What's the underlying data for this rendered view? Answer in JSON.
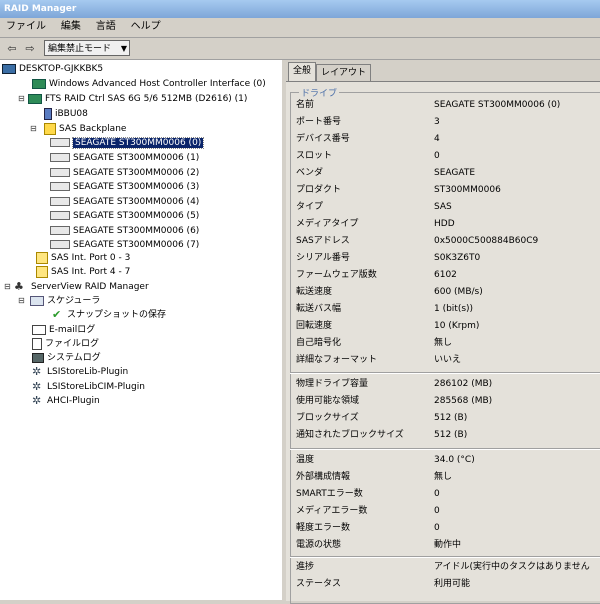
{
  "window": {
    "title": "RAID Manager"
  },
  "menu": [
    "ファイル",
    "編集",
    "言語",
    "ヘルプ"
  ],
  "toolbar": {
    "back": "⇦",
    "forward": "⇨",
    "mode": "編集禁止モード"
  },
  "tree": {
    "root": "DESKTOP-GJKKBK5",
    "ahci": "Windows Advanced Host Controller Interface (0)",
    "raid": "FTS RAID Ctrl SAS 6G 5/6 512MB (D2616) (1)",
    "bbu": "iBBU08",
    "backplane": "SAS Backplane",
    "disks": [
      "SEAGATE ST300MM0006 (0)",
      "SEAGATE ST300MM0006 (1)",
      "SEAGATE ST300MM0006 (2)",
      "SEAGATE ST300MM0006 (3)",
      "SEAGATE ST300MM0006 (4)",
      "SEAGATE ST300MM0006 (5)",
      "SEAGATE ST300MM0006 (6)",
      "SEAGATE ST300MM0006 (7)"
    ],
    "ports": [
      "SAS Int. Port 0 - 3",
      "SAS Int. Port 4 - 7"
    ],
    "serverview": "ServerView RAID Manager",
    "scheduler": "スケジューラ",
    "snapshot": "スナップショットの保存",
    "email": "E-mailログ",
    "filelog": "ファイルログ",
    "syslog": "システムログ",
    "plugins": [
      "LSIStoreLib-Plugin",
      "LSIStoreLibCIM-Plugin",
      "AHCI-Plugin"
    ]
  },
  "tabs": [
    "全般",
    "レイアウト"
  ],
  "group_title": "ドライブ",
  "props1": [
    {
      "label": "名前",
      "value": "SEAGATE ST300MM0006 (0)"
    },
    {
      "label": "ポート番号",
      "value": "3"
    },
    {
      "label": "デバイス番号",
      "value": "4"
    },
    {
      "label": "スロット",
      "value": "0"
    },
    {
      "label": "ベンダ",
      "value": "SEAGATE"
    },
    {
      "label": "プロダクト",
      "value": "ST300MM0006"
    },
    {
      "label": "タイプ",
      "value": "SAS"
    },
    {
      "label": "メディアタイプ",
      "value": "HDD"
    },
    {
      "label": "SASアドレス",
      "value": "0x5000C500884B60C9"
    },
    {
      "label": "シリアル番号",
      "value": "S0K3Z6T0"
    },
    {
      "label": "ファームウェア版数",
      "value": "6102"
    },
    {
      "label": "転送速度",
      "value": "600 (MB/s)"
    },
    {
      "label": "転送バス幅",
      "value": "1 (bit(s))"
    },
    {
      "label": "回転速度",
      "value": "10 (Krpm)"
    },
    {
      "label": "自己暗号化",
      "value": "無し"
    },
    {
      "label": "詳細なフォーマット",
      "value": "いいえ"
    }
  ],
  "props2": [
    {
      "label": "物理ドライブ容量",
      "value": "286102 (MB)"
    },
    {
      "label": "使用可能な領域",
      "value": "285568 (MB)"
    },
    {
      "label": "ブロックサイズ",
      "value": "512 (B)"
    },
    {
      "label": "通知されたブロックサイズ",
      "value": "512 (B)"
    }
  ],
  "props3": [
    {
      "label": "温度",
      "value": "34.0 (°C)"
    },
    {
      "label": "外部構成情報",
      "value": "無し"
    },
    {
      "label": "SMARTエラー数",
      "value": "0"
    },
    {
      "label": "メディアエラー数",
      "value": "0"
    },
    {
      "label": "軽度エラー数",
      "value": "0"
    },
    {
      "label": "電源の状態",
      "value": "動作中"
    }
  ],
  "props4": [
    {
      "label": "進捗",
      "value": "アイドル(実行中のタスクはありません"
    },
    {
      "label": "ステータス",
      "value": "利用可能"
    }
  ]
}
